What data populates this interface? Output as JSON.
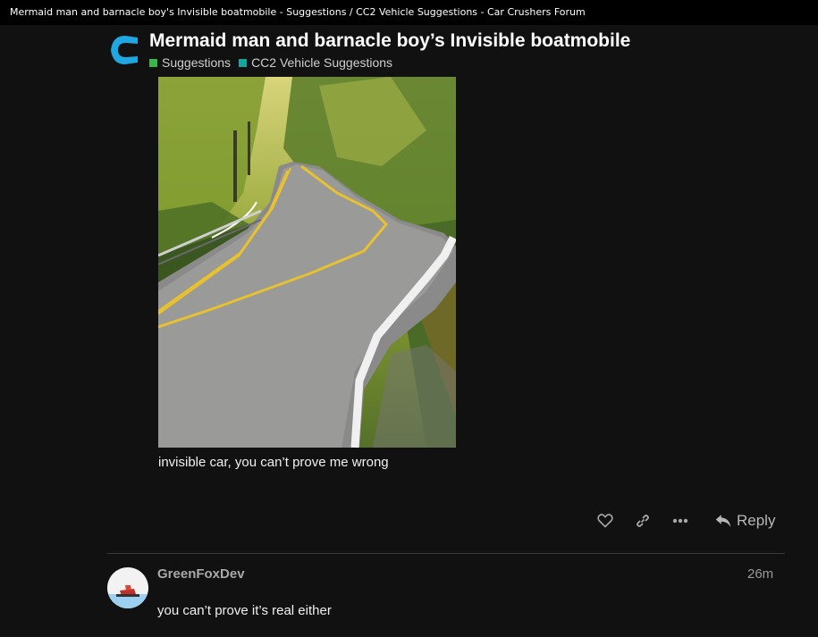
{
  "window": {
    "title": "Mermaid man and barnacle boy's Invisible boatmobile - Suggestions / CC2 Vehicle Suggestions - Car Crushers Forum"
  },
  "topic": {
    "title": "Mermaid man and barnacle boy’s Invisible boatmobile",
    "categories": [
      {
        "label": "Suggestions",
        "color": "#3ab54a"
      },
      {
        "label": "CC2 Vehicle Suggestions",
        "color": "#12a89d"
      }
    ]
  },
  "post": {
    "image_icon": "winding-road-photo",
    "caption": "invisible car, you can’t prove me wrong",
    "actions": {
      "like_icon": "heart-icon",
      "link_icon": "link-icon",
      "more_icon": "ellipsis-icon",
      "reply_label": "Reply"
    }
  },
  "reply": {
    "username": "GreenFoxDev",
    "age": "26m",
    "text": "you can’t prove it’s real either"
  },
  "colors": {
    "background": "#111111",
    "accent": "#1ea7e1"
  }
}
